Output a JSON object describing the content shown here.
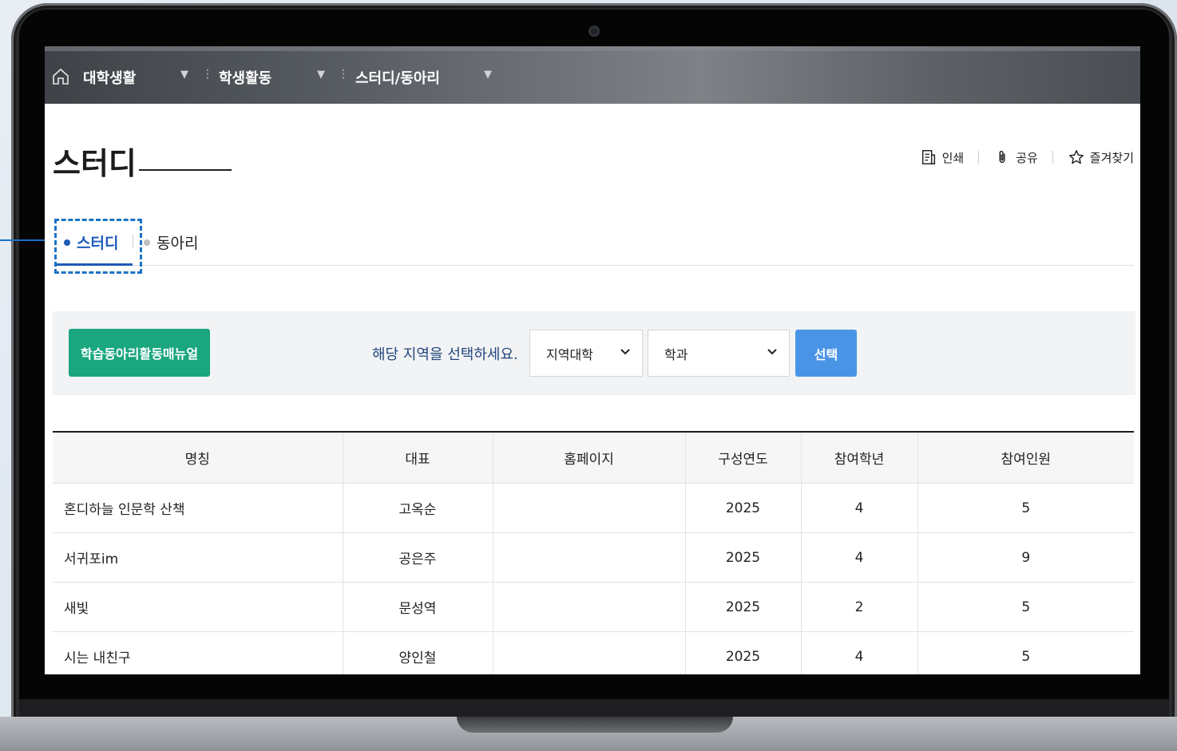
{
  "breadcrumb": [
    {
      "label": "대학생활"
    },
    {
      "label": "학생활동"
    },
    {
      "label": "스터디/동아리"
    }
  ],
  "page": {
    "title": "스터디"
  },
  "toolbar": {
    "print": "인쇄",
    "share": "공유",
    "favorite": "즐겨찾기"
  },
  "tabs": [
    {
      "label": "스터디",
      "active": true
    },
    {
      "label": "동아리",
      "active": false
    }
  ],
  "filter": {
    "manual_button": "학습동아리활동매뉴얼",
    "prompt": "해당 지역을 선택하세요.",
    "region_select": "지역대학",
    "dept_select": "학과",
    "submit_button": "선택"
  },
  "table": {
    "columns": [
      "명칭",
      "대표",
      "홈페이지",
      "구성연도",
      "참여학년",
      "참여인원"
    ],
    "rows": [
      [
        "혼디하늘 인문학 산책",
        "고옥순",
        "",
        "2025",
        "4",
        "5"
      ],
      [
        "서귀포im",
        "공은주",
        "",
        "2025",
        "4",
        "9"
      ],
      [
        "새빛",
        "문성역",
        "",
        "2025",
        "2",
        "5"
      ],
      [
        "시는 내친구",
        "양인철",
        "",
        "2025",
        "4",
        "5"
      ]
    ]
  },
  "colors": {
    "accent": "#1e5bb8",
    "manual_button": "#1aa67f",
    "select_button": "#4a94e6",
    "callout": "#1a73c7"
  }
}
